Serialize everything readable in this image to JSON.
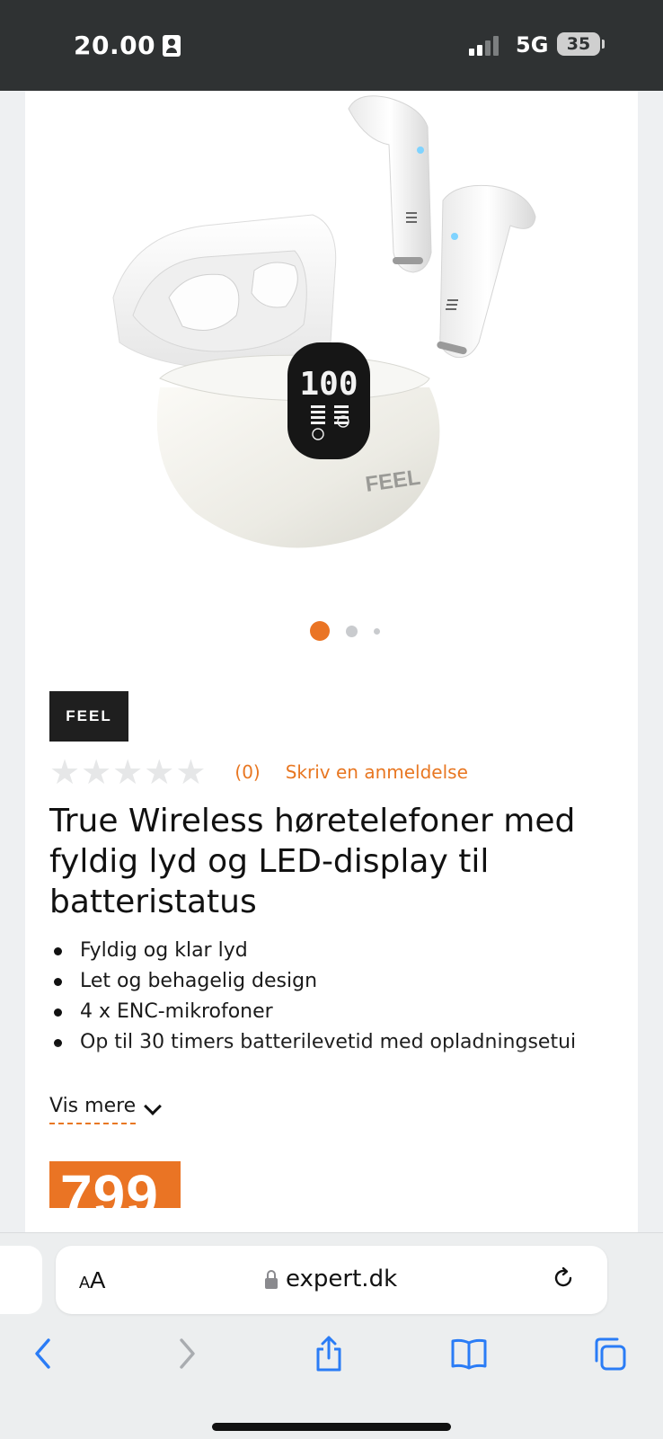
{
  "status_bar": {
    "time": "20.00",
    "network": "5G",
    "battery": "35",
    "signal_bars_filled": 2,
    "signal_bars_total": 4
  },
  "product": {
    "brand_logo_text": "FEEL",
    "carousel": {
      "total": 3,
      "active": 1
    },
    "rating": {
      "stars_filled": 0,
      "stars_total": 5,
      "count": "(0)",
      "review_link": "Skriv en anmeldelse"
    },
    "title": "True Wireless høretelefoner med fyldig lyd og LED-display til batteristatus",
    "features": [
      "Fyldig og klar lyd",
      "Let og behagelig design",
      "4 x ENC-mikrofoner",
      "Op til 30 timers batterilevetid med opladningsetui"
    ],
    "show_more": "Vis mere",
    "price": "799"
  },
  "browser": {
    "text_size": "AA",
    "url": "expert.dk"
  },
  "colors": {
    "accent": "#ea7424",
    "status_bar": "#2f3233"
  }
}
